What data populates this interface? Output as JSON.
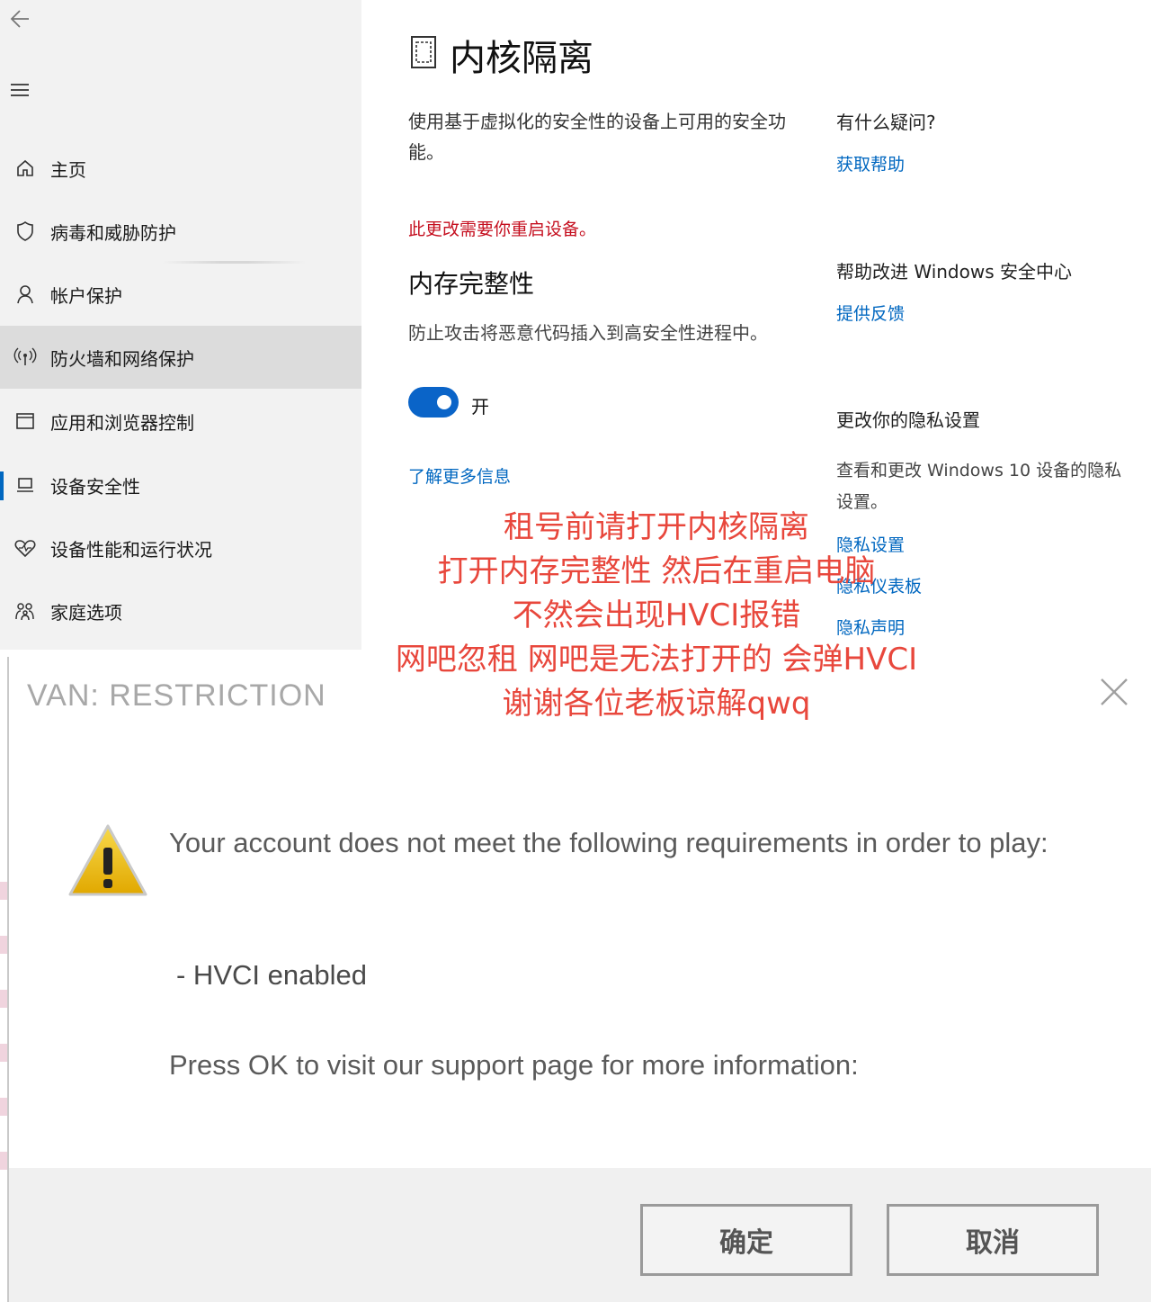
{
  "sidebar": {
    "items": [
      {
        "label": "主页",
        "icon": "home-icon"
      },
      {
        "label": "病毒和威胁防护",
        "icon": "shield-icon"
      },
      {
        "label": "帐户保护",
        "icon": "person-icon"
      },
      {
        "label": "防火墙和网络保护",
        "icon": "wifi-antenna-icon"
      },
      {
        "label": "应用和浏览器控制",
        "icon": "app-window-icon"
      },
      {
        "label": "设备安全性",
        "icon": "laptop-icon"
      },
      {
        "label": "设备性能和运行状况",
        "icon": "heart-icon"
      },
      {
        "label": "家庭选项",
        "icon": "family-icon"
      }
    ]
  },
  "main": {
    "title": "内核隔离",
    "description": "使用基于虚拟化的安全性的设备上可用的安全功能。",
    "restart_note": "此更改需要你重启设备。",
    "memory_integrity": {
      "title": "内存完整性",
      "description": "防止攻击将恶意代码插入到高安全性进程中。",
      "toggle_state": "开",
      "toggle_on": true
    },
    "learn_more": "了解更多信息"
  },
  "right_column": {
    "questions_heading": "有什么疑问?",
    "get_help": "获取帮助",
    "improve_heading": "帮助改进 Windows 安全中心",
    "feedback": "提供反馈",
    "privacy_heading": "更改你的隐私设置",
    "privacy_text": "查看和更改 Windows 10 设备的隐私设置。",
    "privacy_links": [
      "隐私设置",
      "隐私仪表板",
      "隐私声明"
    ]
  },
  "overlay": {
    "color": "#e8473c",
    "lines": [
      "租号前请打开内核隔离",
      "打开内存完整性 然后在重启电脑",
      "不然会出现HVCI报错",
      "网吧忽租 网吧是无法打开的 会弹HVCI",
      "谢谢各位老板谅解qwq"
    ]
  },
  "dialog": {
    "title": "VAN: RESTRICTION",
    "message": "Your account does not meet the following requirements in order to play:",
    "requirement": "- HVCI enabled",
    "press_ok": "Press OK to visit our support page for more information:",
    "ok_label": "确定",
    "cancel_label": "取消"
  }
}
